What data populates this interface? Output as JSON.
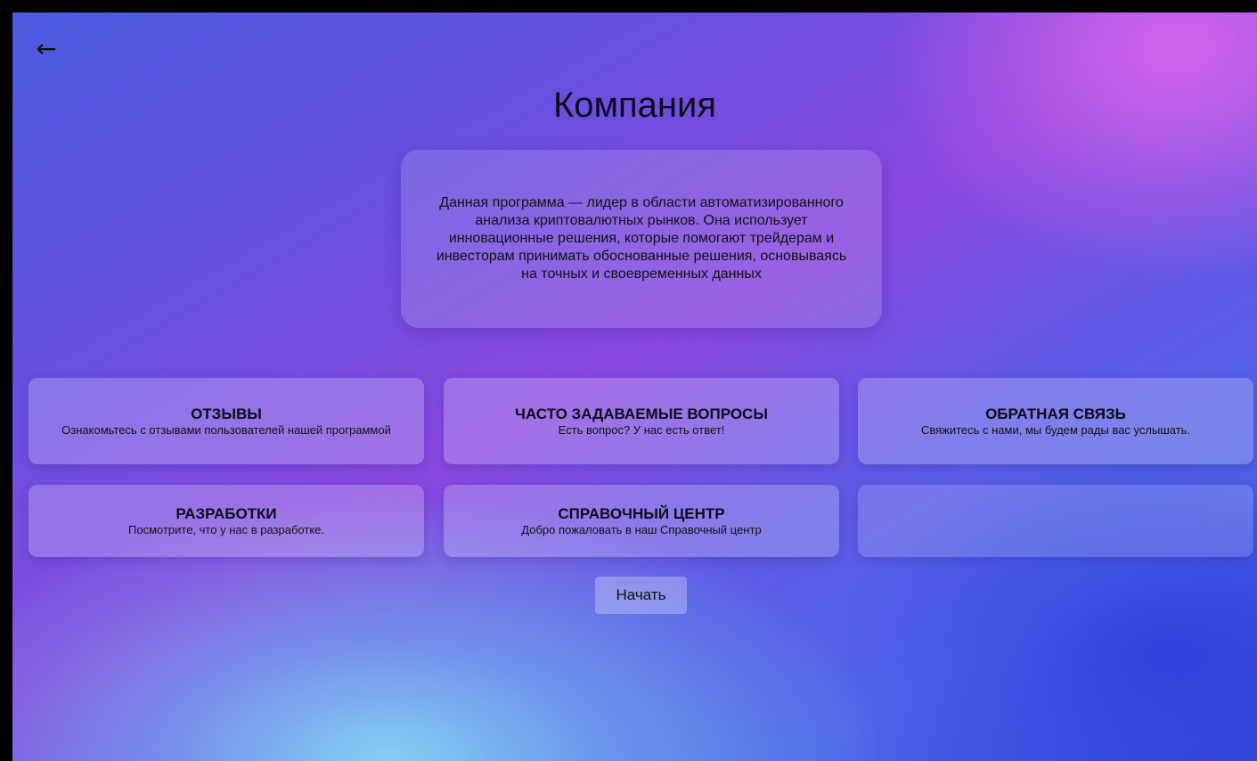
{
  "nav": {
    "back_icon": "←"
  },
  "header": {
    "title": "Компания"
  },
  "about": {
    "text": "Данная программа — лидер в области автоматизированного анализа криптовалютных рынков. Она использует инновационные решения, которые помогают трейдерам и инвесторам принимать обоснованные решения, основываясь на точных и своевременных данных"
  },
  "cards": [
    {
      "title": "ОТЗЫВЫ",
      "subtitle": "Ознакомьтесь с отзывами пользователей нашей программой"
    },
    {
      "title": "ЧАСТО ЗАДАВАЕМЫЕ ВОПРОСЫ",
      "subtitle": "Есть вопрос? У нас есть ответ!"
    },
    {
      "title": "ОБРАТНАЯ СВЯЗЬ",
      "subtitle": "Свяжитесь с нами, мы будем рады вас услышать."
    },
    {
      "title": "РАЗРАБОТКИ",
      "subtitle": "Посмотрите, что у нас в разработке."
    },
    {
      "title": "СПРАВОЧНЫЙ ЦЕНТР",
      "subtitle": "Добро пожаловать в наш Справочный центр"
    }
  ],
  "actions": {
    "start_label": "Начать"
  }
}
